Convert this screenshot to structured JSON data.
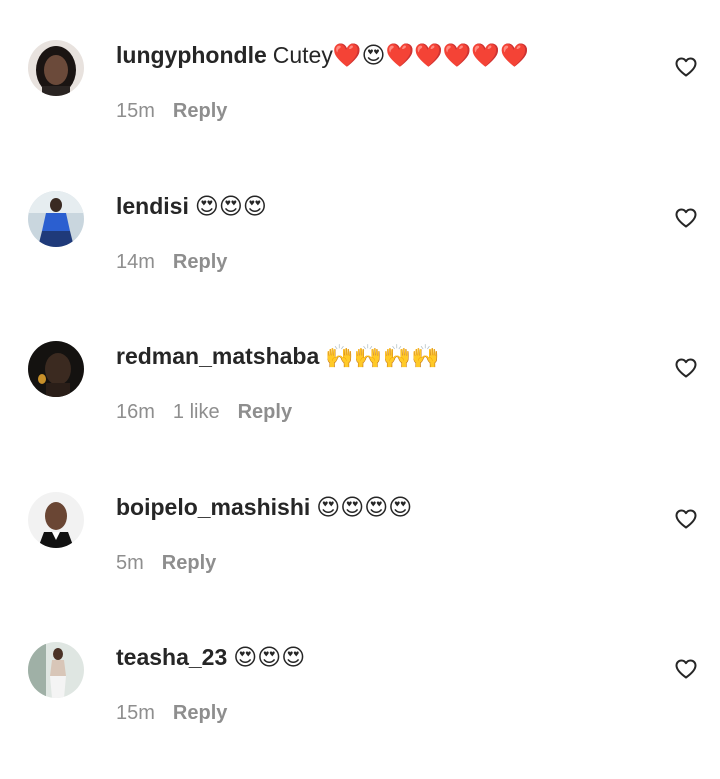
{
  "comments": [
    {
      "username": "lungyphondle",
      "text": "Cutey❤️😍❤️❤️❤️❤️❤️",
      "time": "15m",
      "likes": "",
      "reply_label": "Reply"
    },
    {
      "username": "lendisi",
      "text": "😍😍😍",
      "time": "14m",
      "likes": "",
      "reply_label": "Reply"
    },
    {
      "username": "redman_matshaba",
      "text": "🙌🙌🙌🙌",
      "time": "16m",
      "likes": "1 like",
      "reply_label": "Reply"
    },
    {
      "username": "boipelo_mashishi",
      "text": "😍😍😍😍",
      "time": "5m",
      "likes": "",
      "reply_label": "Reply"
    },
    {
      "username": "teasha_23",
      "text": "😍😍😍",
      "time": "15m",
      "likes": "",
      "reply_label": "Reply"
    }
  ],
  "icons": {
    "like": "heart-outline-icon",
    "avatar": "profile-picture"
  }
}
